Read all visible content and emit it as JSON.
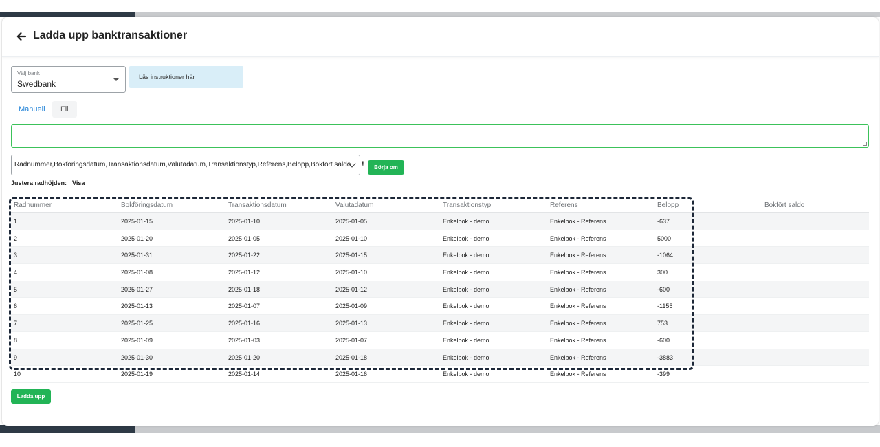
{
  "header": {
    "title": "Ladda upp banktransaktioner",
    "back_icon": "arrow-left-icon"
  },
  "bank_select": {
    "label": "Välj bank",
    "value": "Swedbank",
    "caret_icon": "caret-down-icon"
  },
  "instructions": {
    "label": "Läs instruktioner här"
  },
  "tabs": [
    {
      "label": "Manuell",
      "active": true
    },
    {
      "label": "Fil",
      "active": false
    }
  ],
  "input": {
    "value": ""
  },
  "columns_select": {
    "value": "Radnummer,Bokföringsdatum,Transaktionsdatum,Valutadatum,Transaktionstyp,Referens,Belopp,Bokfört saldo",
    "chevron_icon": "chevron-down-icon",
    "warning": "!"
  },
  "buttons": {
    "borja_om": "Börja om",
    "ladda_upp": "Ladda upp"
  },
  "row_height": {
    "label": "Justera radhöjden:",
    "action": "Visa"
  },
  "table": {
    "columns": [
      "Radnummer",
      "Bokföringsdatum",
      "Transaktionsdatum",
      "Valutadatum",
      "Transaktionstyp",
      "Referens",
      "Belopp",
      "Bokfört saldo"
    ],
    "rows": [
      [
        "1",
        "2025-01-15",
        "2025-01-10",
        "2025-01-05",
        "Enkelbok - demo",
        "Enkelbok - Referens",
        "-637",
        ""
      ],
      [
        "2",
        "2025-01-20",
        "2025-01-05",
        "2025-01-10",
        "Enkelbok - demo",
        "Enkelbok - Referens",
        "5000",
        ""
      ],
      [
        "3",
        "2025-01-31",
        "2025-01-22",
        "2025-01-15",
        "Enkelbok - demo",
        "Enkelbok - Referens",
        "-1064",
        ""
      ],
      [
        "4",
        "2025-01-08",
        "2025-01-12",
        "2025-01-10",
        "Enkelbok - demo",
        "Enkelbok - Referens",
        "300",
        ""
      ],
      [
        "5",
        "2025-01-27",
        "2025-01-18",
        "2025-01-12",
        "Enkelbok - demo",
        "Enkelbok - Referens",
        "-600",
        ""
      ],
      [
        "6",
        "2025-01-13",
        "2025-01-07",
        "2025-01-09",
        "Enkelbok - demo",
        "Enkelbok - Referens",
        "-1155",
        ""
      ],
      [
        "7",
        "2025-01-25",
        "2025-01-16",
        "2025-01-13",
        "Enkelbok - demo",
        "Enkelbok - Referens",
        "753",
        ""
      ],
      [
        "8",
        "2025-01-09",
        "2025-01-03",
        "2025-01-07",
        "Enkelbok - demo",
        "Enkelbok - Referens",
        "-600",
        ""
      ],
      [
        "9",
        "2025-01-30",
        "2025-01-20",
        "2025-01-18",
        "Enkelbok - demo",
        "Enkelbok - Referens",
        "-3883",
        ""
      ],
      [
        "10",
        "2025-01-19",
        "2025-01-14",
        "2025-01-16",
        "Enkelbok - demo",
        "Enkelbok - Referens",
        "-399",
        ""
      ]
    ]
  },
  "colors": {
    "accent_green": "#22b456",
    "link_blue": "#1b7fd6",
    "info_bg": "#d9eef8",
    "highlight_border": "#1d2838"
  }
}
